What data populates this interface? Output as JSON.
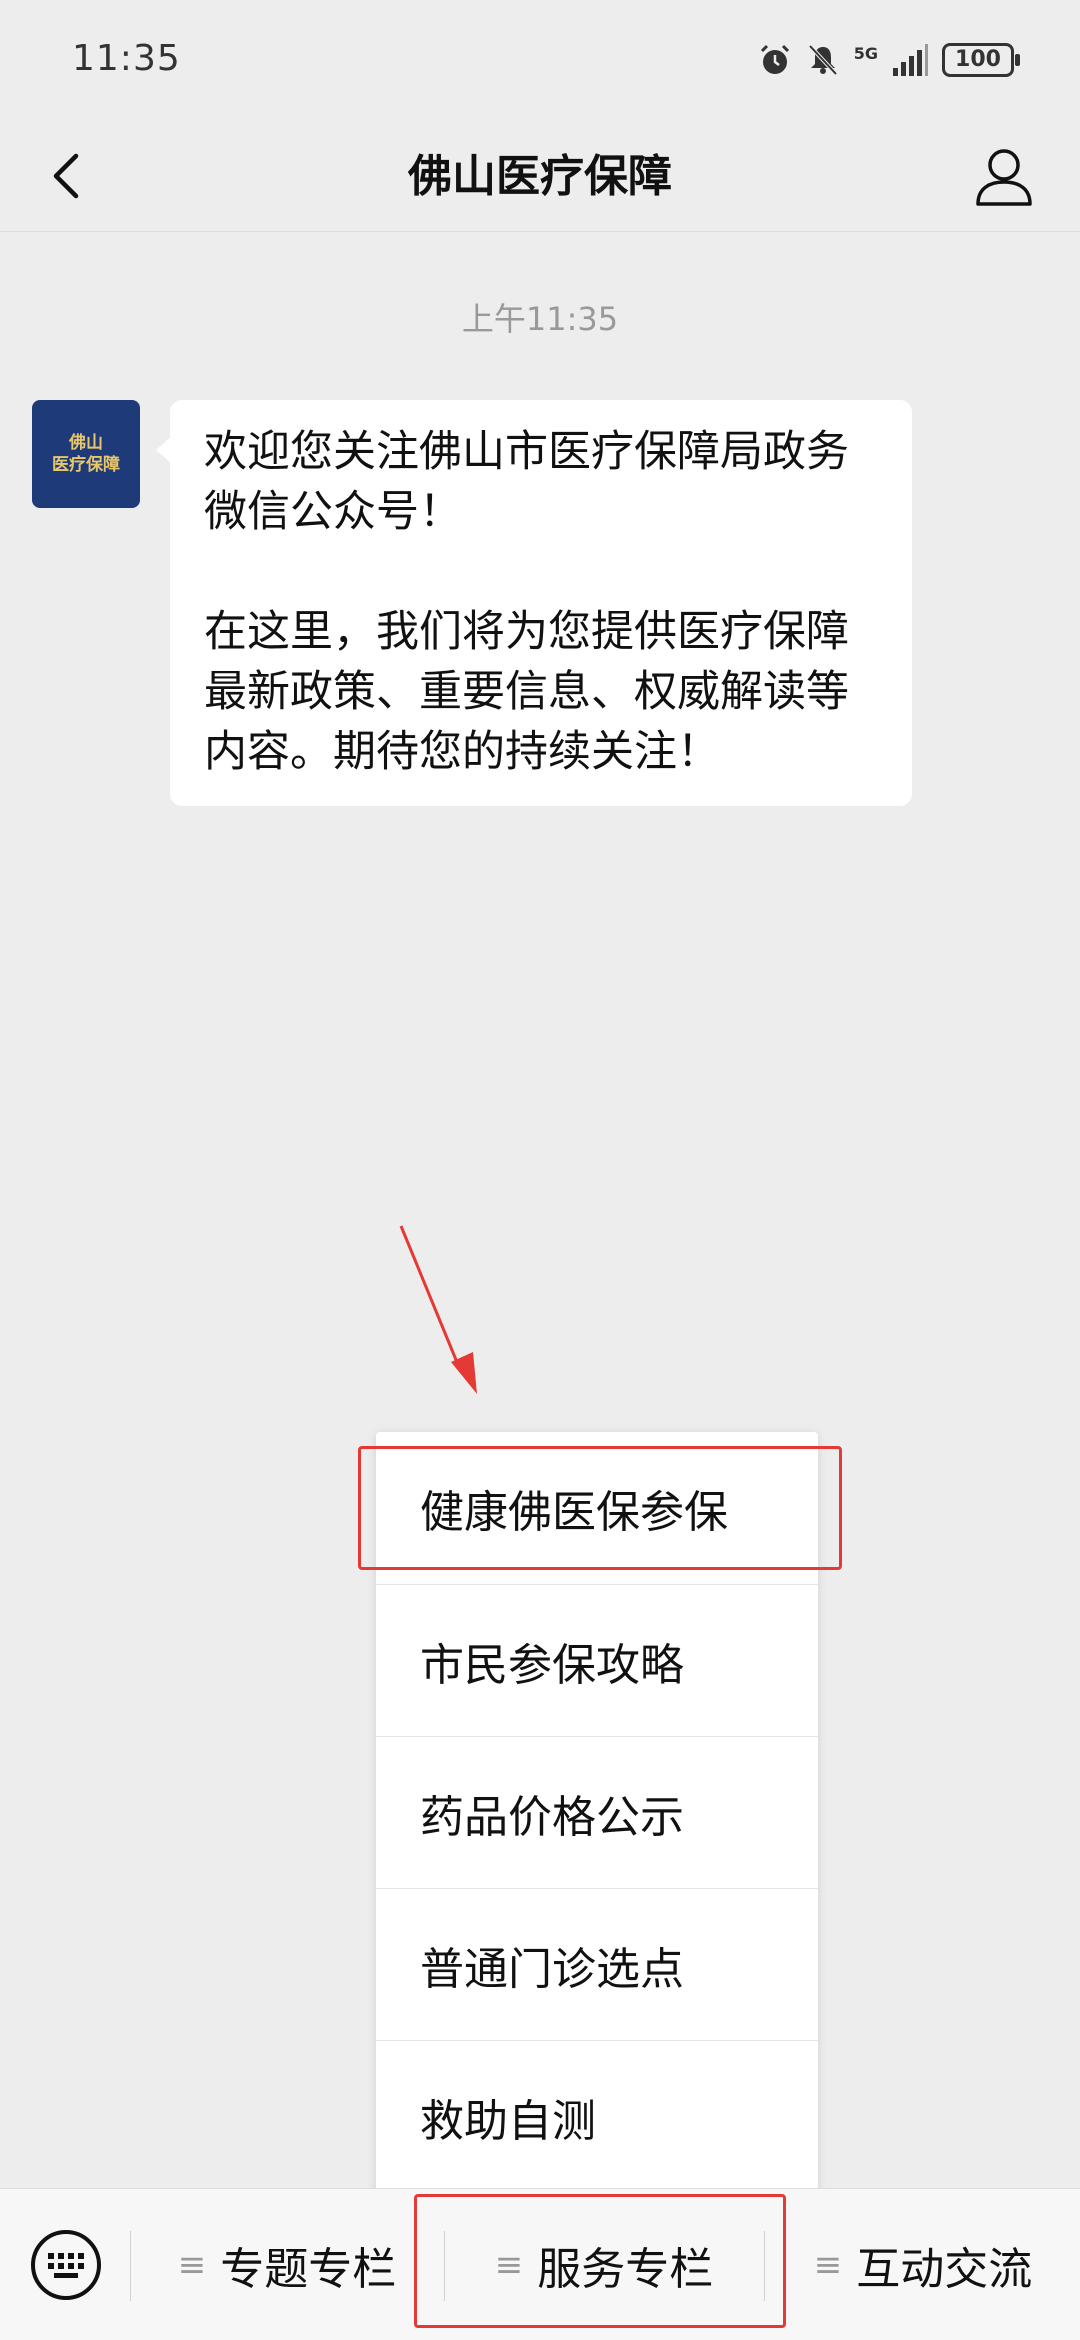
{
  "status_bar": {
    "time": "11:35",
    "network": "5G",
    "battery": "100",
    "icons": [
      "alarm-icon",
      "mute-icon",
      "signal-icon",
      "battery-icon"
    ]
  },
  "nav": {
    "title": "佛山医疗保障",
    "back_icon": "chevron-left-icon",
    "profile_icon": "person-icon"
  },
  "chat": {
    "timestamp": "上午11:35",
    "avatar_lines": [
      "佛山",
      "医疗保障"
    ],
    "message": {
      "paragraph1": "欢迎您关注佛山市医疗保障局政务微信公众号！",
      "paragraph2": "在这里，我们将为您提供医疗保障最新政策、重要信息、权威解读等内容。期待您的持续关注！"
    }
  },
  "popup_menu": {
    "items": [
      "健康佛医保参保",
      "市民参保攻略",
      "药品价格公示",
      "普通门诊选点",
      "救助自测"
    ]
  },
  "bottom_menu": {
    "keyboard_icon": "keyboard-icon",
    "tabs": [
      "专题专栏",
      "服务专栏",
      "互动交流"
    ]
  },
  "colors": {
    "background": "#ededed",
    "bubble": "#ffffff",
    "avatar": "#1e3a78",
    "highlight": "#e53935"
  }
}
